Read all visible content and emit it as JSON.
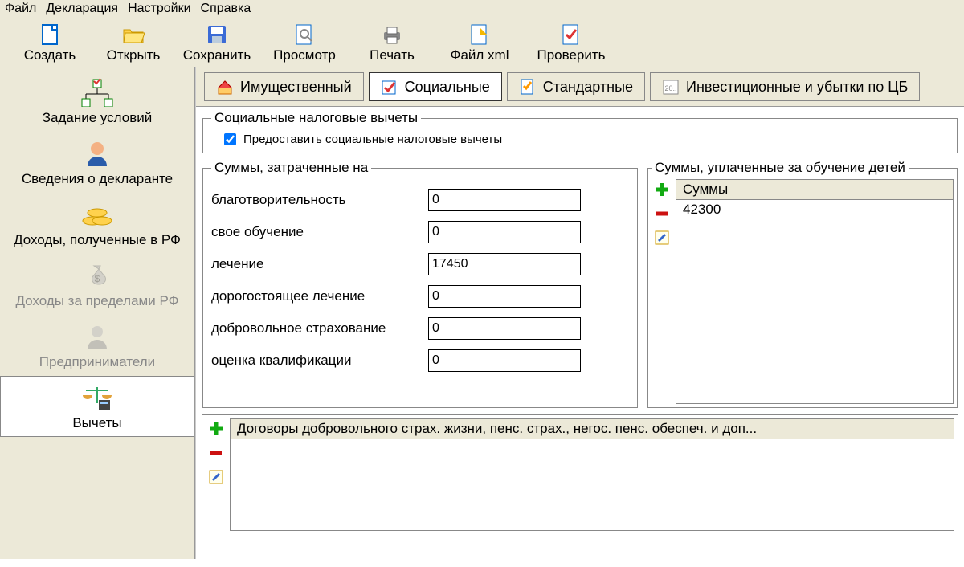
{
  "menu": {
    "file": "Файл",
    "decl": "Декларация",
    "settings": "Настройки",
    "help": "Справка"
  },
  "toolbar": {
    "create": "Создать",
    "open": "Открыть",
    "save": "Сохранить",
    "preview": "Просмотр",
    "print": "Печать",
    "filexml": "Файл xml",
    "check": "Проверить"
  },
  "sidebar": {
    "items": [
      {
        "label": "Задание условий"
      },
      {
        "label": "Сведения о декларанте"
      },
      {
        "label": "Доходы, полученные в РФ"
      },
      {
        "label": "Доходы за пределами РФ"
      },
      {
        "label": "Предприниматели"
      },
      {
        "label": "Вычеты"
      }
    ]
  },
  "tabs": {
    "property": "Имущественный",
    "social": "Социальные",
    "standard": "Стандартные",
    "invest": "Инвестиционные и убытки по ЦБ"
  },
  "group_title": "Социальные налоговые вычеты",
  "checkbox_label": "Предоставить социальные налоговые вычеты",
  "sums_title": "Суммы, затраченные на",
  "fields": {
    "charity": {
      "label": "благотворительность",
      "value": "0"
    },
    "own_edu": {
      "label": "свое обучение",
      "value": "0"
    },
    "treatment": {
      "label": "лечение",
      "value": "17450"
    },
    "exp_treatment": {
      "label": "дорогостоящее лечение",
      "value": "0"
    },
    "insurance": {
      "label": "добровольное страхование",
      "value": "0"
    },
    "qualif": {
      "label": "оценка квалификации",
      "value": "0"
    }
  },
  "child_title": "Суммы, уплаченные за обучение детей",
  "child_header": "Суммы",
  "child_rows": [
    "42300"
  ],
  "contracts_header": "Договоры добровольного страх. жизни, пенс. страх., негос. пенс. обеспеч. и доп..."
}
